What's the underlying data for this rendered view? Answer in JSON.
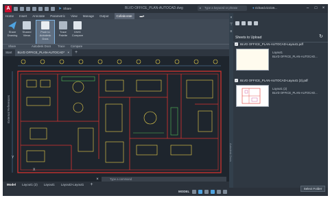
{
  "app": {
    "logo_letter": "A",
    "title": "BLVD OFFICE_PLAN-AUTOCAD.dwg",
    "search_placeholder": "Type a keyword or phrase",
    "user_name": "richard.rizzi19...",
    "share_button": "Share"
  },
  "ribbon": {
    "tabs": [
      "Home",
      "Insert",
      "Annotate",
      "Parametric",
      "View",
      "Manage",
      "Output",
      "Collaborate"
    ],
    "active_tab": "Collaborate",
    "buttons": [
      {
        "label": "Share Drawing"
      },
      {
        "label": "Shared Views"
      },
      {
        "label": "Push to Autodesk Docs"
      },
      {
        "label": "Trace Palette"
      },
      {
        "label": "DWG Compare"
      }
    ],
    "groups": [
      "Share",
      "Autodesk Docs",
      "Trace",
      "Compare"
    ]
  },
  "doc_tabs": {
    "start": "Start",
    "drawing": "BLVD OFFICE_PLAN-AUTOCAD*",
    "close": "×",
    "add": "+"
  },
  "canvas": {
    "viewport_label": "External References",
    "command_placeholder": "Type a command",
    "axis_y": "Y",
    "axis_x": "X",
    "command_close": "×"
  },
  "layout_tabs": [
    "Model",
    "Layout1 (2)",
    "Layout1",
    "Layout2-Layout1",
    "+"
  ],
  "layout_tabs_active": "Model",
  "status": {
    "model_label": "MODEL"
  },
  "nav_strip": {
    "label": "Autodesk Docs"
  },
  "panel": {
    "title": "Sheets to Upload",
    "sheets": [
      {
        "checked": true,
        "name": "BLVD OFFICE_PLAN-AUTOCAD-Layout1.pdf",
        "sub1": "Layout1",
        "sub2": "BLVD OFFICE_PLAN-AUTOCAD..."
      },
      {
        "checked": true,
        "name": "BLVD OFFICE_PLAN-AUTOCAD-Layout1 (2).pdf",
        "sub1": "Layout1 (2)",
        "sub2": "BLVD OFFICE_PLAN-AUTOCAD..."
      }
    ],
    "select_folder": "Select Folder"
  },
  "colors": {
    "accent_red": "#c8102e",
    "plan_wall": "#e0342f",
    "plan_furniture": "#f2d94e",
    "plan_green": "#55c25a",
    "canvas_bg": "#1e252d"
  }
}
